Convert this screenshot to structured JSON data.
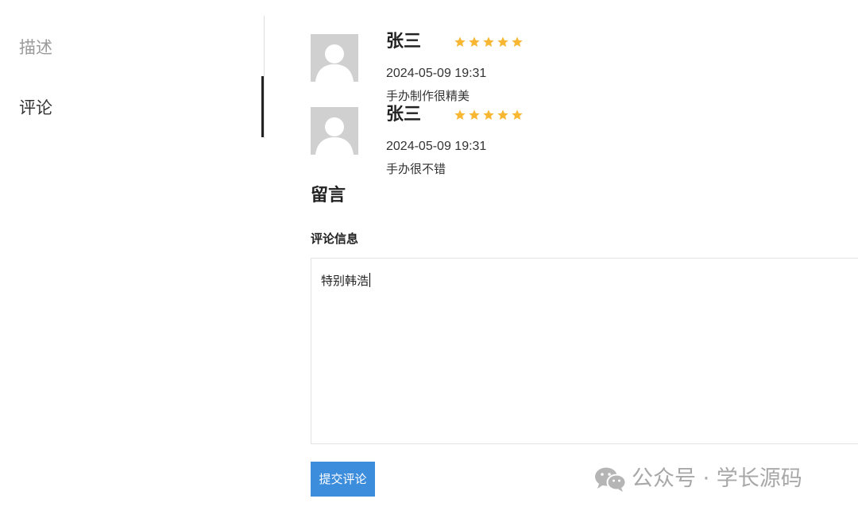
{
  "tabs": {
    "description": "描述",
    "reviews": "评论"
  },
  "reviews": [
    {
      "name": "张三",
      "rating": 5,
      "time": "2024-05-09 19:31",
      "text": "手办制作很精美"
    },
    {
      "name": "张三",
      "rating": 5,
      "time": "2024-05-09 19:31",
      "text": "手办很不错"
    }
  ],
  "form": {
    "title": "留言",
    "comment_label": "评论信息",
    "comment_value": "特别韩浩",
    "submit_label": "提交评论"
  },
  "watermark": {
    "text": "公众号 · 学长源码",
    "icon": "wechat-icon"
  },
  "colors": {
    "star": "#f7b733",
    "submit_button": "#3c8ddc",
    "avatar_bg": "#d0d0d0"
  }
}
